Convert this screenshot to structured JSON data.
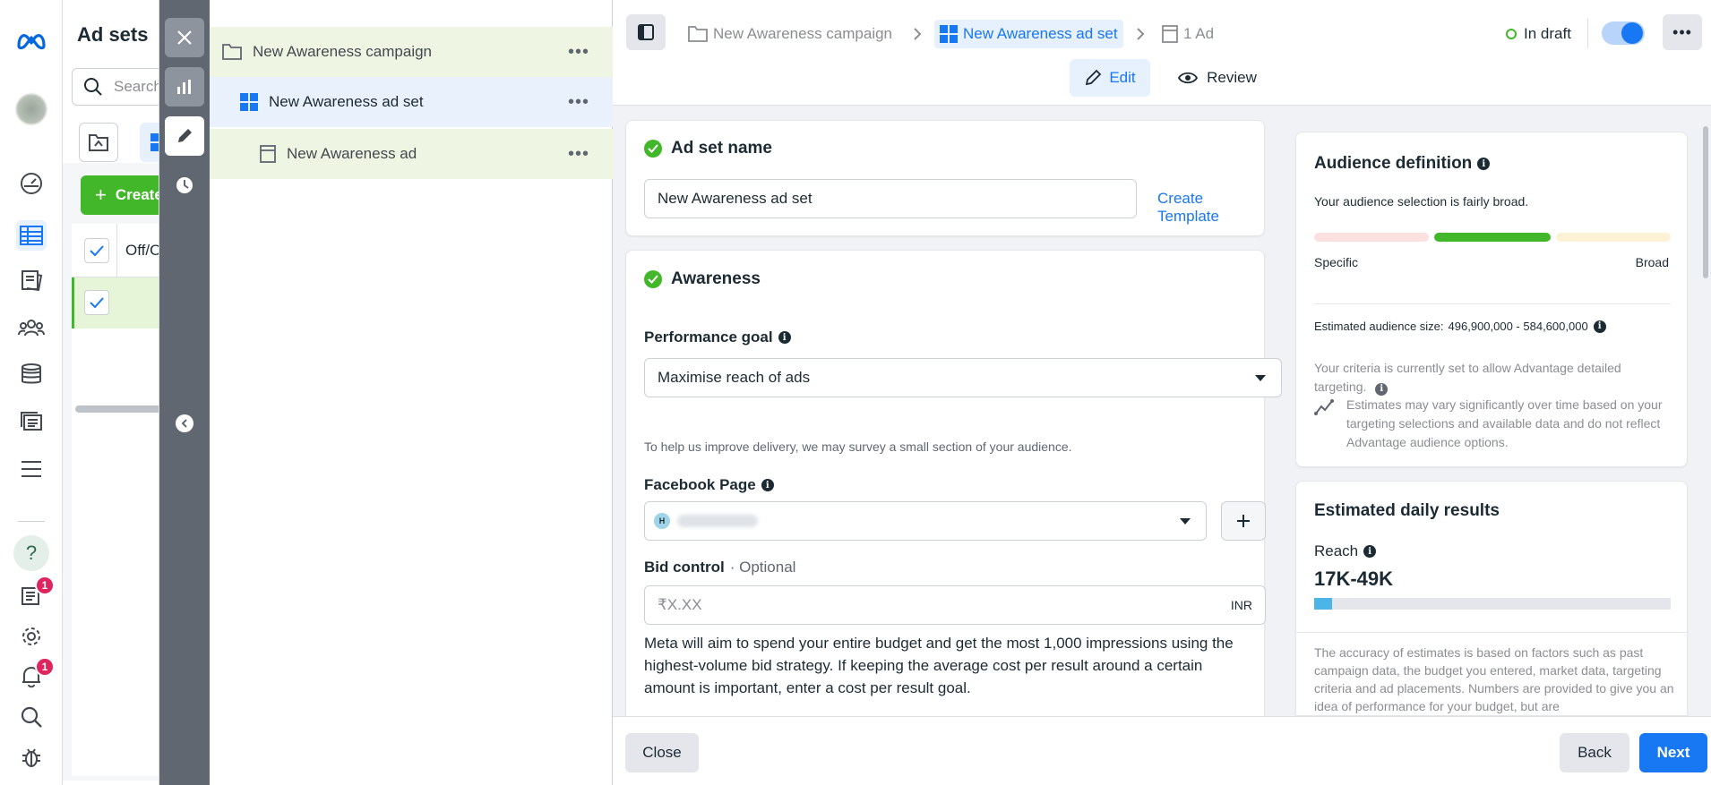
{
  "colors": {
    "brand_blue": "#1877f2",
    "success_green": "#42b72a",
    "draft_green": "#42b72a",
    "badge_red": "#e0245e",
    "selected_row": "#f1f8e9"
  },
  "rail": {
    "icons": [
      "meta-logo-icon",
      "profile-avatar",
      "dashboard-icon",
      "ads-manager-table-icon",
      "catalog-icon",
      "audiences-icon",
      "billing-icon",
      "media-library-icon",
      "menu-icon",
      "help-icon",
      "notifications-inbox-icon",
      "settings-icon",
      "alerts-bell-icon",
      "search-icon",
      "bug-report-icon"
    ],
    "inbox_badge": "1",
    "bell_badge": "1",
    "help_glyph": "?"
  },
  "adsets_panel": {
    "title": "Ad sets",
    "search_placeholder": "Search",
    "create_label": "Create",
    "column_header": "Off/On"
  },
  "tree": {
    "campaign": "New Awareness campaign",
    "adset": "New Awareness ad set",
    "ad": "New Awareness ad"
  },
  "topbar": {
    "breadcrumb": {
      "campaign": "New Awareness campaign",
      "adset": "New Awareness ad set",
      "ad": "1 Ad"
    },
    "status": "In draft",
    "toggle_on": true,
    "tabs": {
      "edit": "Edit",
      "review": "Review"
    }
  },
  "adset_name_card": {
    "title": "Ad set name",
    "value": "New Awareness ad set",
    "create_template": "Create Template"
  },
  "awareness_card": {
    "title": "Awareness",
    "performance_goal_label": "Performance goal",
    "performance_goal_value": "Maximise reach of ads",
    "survey_note": "To help us improve delivery, we may survey a small section of your audience.",
    "facebook_page_label": "Facebook Page",
    "facebook_page_avatar": "H",
    "bid_control_label": "Bid control",
    "bid_control_optional": "· Optional",
    "bid_placeholder": "₹X.XX",
    "bid_currency": "INR",
    "bid_description": "Meta will aim to spend your entire budget and get the most 1,000 impressions using the highest-volume bid strategy. If keeping the average cost per result around a certain amount is important, enter a cost per result goal."
  },
  "audience_definition": {
    "title": "Audience definition",
    "summary": "Your audience selection is fairly broad.",
    "left_label": "Specific",
    "right_label": "Broad",
    "estimated_size_label": "Estimated audience size:",
    "estimated_size_value": "496,900,000 - 584,600,000",
    "criteria_note": "Your criteria is currently set to allow Advantage detailed targeting.",
    "estimates_note": "Estimates may vary significantly over time based on your targeting selections and available data and do not reflect Advantage audience options."
  },
  "daily_results": {
    "title": "Estimated daily results",
    "reach_label": "Reach",
    "reach_value": "17K-49K",
    "reach_fill_fraction": 0.05,
    "accuracy_note": "The accuracy of estimates is based on factors such as past campaign data, the budget you entered, market data, targeting criteria and ad placements. Numbers are provided to give you an idea of performance for your budget, but are"
  },
  "footer": {
    "close": "Close",
    "back": "Back",
    "next": "Next"
  }
}
